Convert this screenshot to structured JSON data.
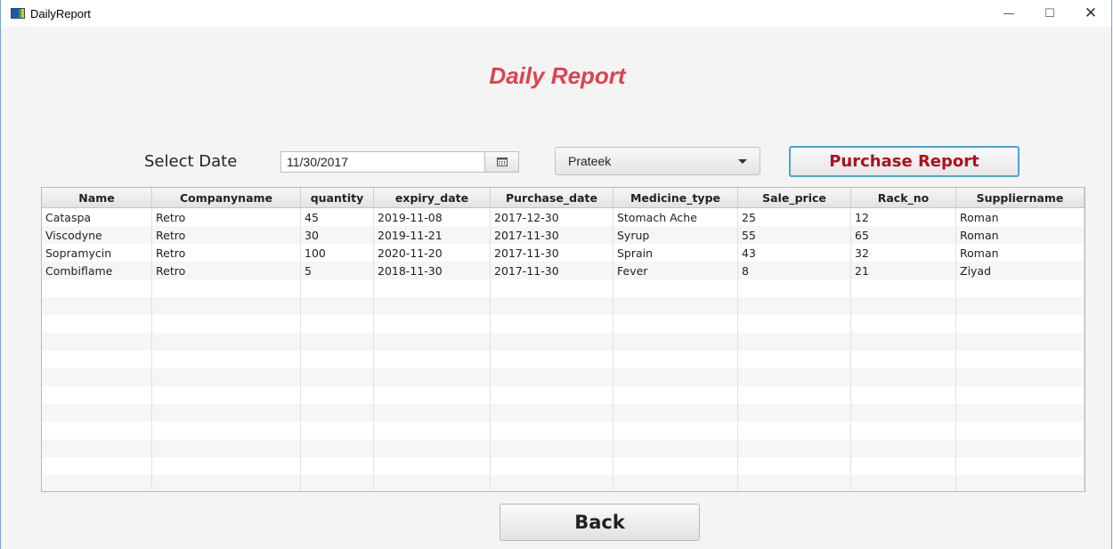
{
  "window": {
    "title": "DailyReport",
    "minimize": "—",
    "maximize": "☐",
    "close": "✕"
  },
  "heading": "Daily Report",
  "filters": {
    "date_label": "Select Date",
    "date_value": "11/30/2017",
    "supplier_selected": "Prateek",
    "purchase_button": "Purchase Report"
  },
  "table": {
    "columns": [
      "Name",
      "Companyname",
      "quantity",
      "expiry_date",
      "Purchase_date",
      "Medicine_type",
      "Sale_price",
      "Rack_no",
      "Suppliername"
    ],
    "rows": [
      [
        "Cataspa",
        "Retro",
        "45",
        "2019-11-08",
        "2017-12-30",
        "Stomach Ache",
        "25",
        "12",
        "Roman"
      ],
      [
        "Viscodyne",
        "Retro",
        "30",
        "2019-11-21",
        "2017-11-30",
        "Syrup",
        "55",
        "65",
        "Roman"
      ],
      [
        "Sopramycin",
        "Retro",
        "100",
        "2020-11-20",
        "2017-11-30",
        "Sprain",
        "43",
        "32",
        "Roman"
      ],
      [
        "Combiflame",
        "Retro",
        "5",
        "2018-11-30",
        "2017-11-30",
        "Fever",
        "8",
        "21",
        "Ziyad"
      ]
    ]
  },
  "back_button": "Back",
  "colors": {
    "heading": "#e0414d",
    "purchase_text": "#b0101a",
    "focus_border": "#4ba3d8"
  }
}
